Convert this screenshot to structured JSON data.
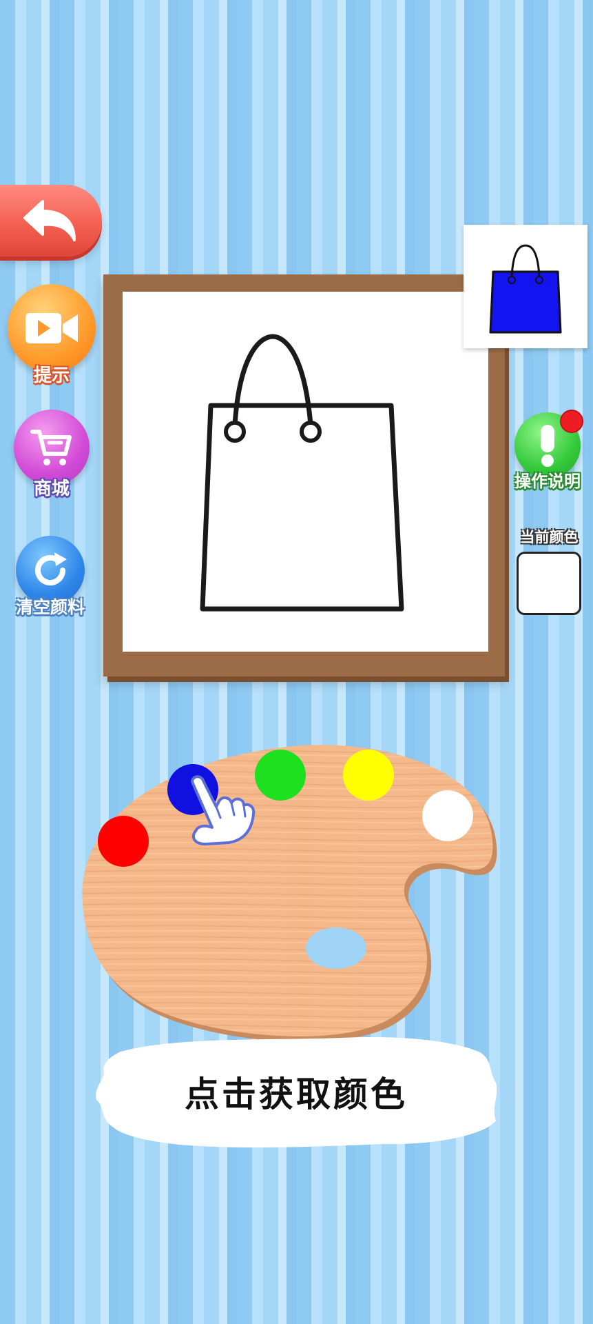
{
  "side_buttons": {
    "hint_label": "提示",
    "shop_label": "商城",
    "clear_label": "清空颜料"
  },
  "help": {
    "label": "操作说明",
    "has_notification": true
  },
  "current_color": {
    "label": "当前颜色",
    "value": "#ffffff"
  },
  "reference": {
    "subject": "shopping bag",
    "fill_color": "#1414f0"
  },
  "palette": {
    "colors": [
      {
        "name": "red",
        "hex": "#ff0000"
      },
      {
        "name": "blue",
        "hex": "#1010e0"
      },
      {
        "name": "green",
        "hex": "#1ee01e"
      },
      {
        "name": "yellow",
        "hex": "#ffff00"
      },
      {
        "name": "white",
        "hex": "#ffffff"
      }
    ]
  },
  "instruction": {
    "text": "点击获取颜色"
  },
  "icons": {
    "back": "back-arrow-icon",
    "hint": "video-camera-icon",
    "shop": "shopping-cart-icon",
    "clear": "refresh-icon",
    "help": "exclamation-icon",
    "pointer": "hand-pointer-icon"
  }
}
